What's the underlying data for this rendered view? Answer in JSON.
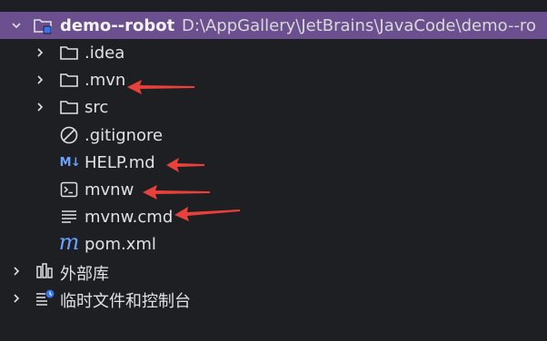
{
  "project": {
    "name": "demo--robot",
    "path": "D:\\AppGallery\\JetBrains\\JavaCode\\demo--ro"
  },
  "items": [
    {
      "label": ".idea",
      "icon": "folder-icon"
    },
    {
      "label": ".mvn",
      "icon": "folder-icon"
    },
    {
      "label": "src",
      "icon": "folder-icon"
    },
    {
      "label": ".gitignore",
      "icon": "ignore-file-icon"
    },
    {
      "label": "HELP.md",
      "icon": "markdown-icon",
      "icon_text": "M↓"
    },
    {
      "label": "mvnw",
      "icon": "terminal-icon"
    },
    {
      "label": "mvnw.cmd",
      "icon": "text-file-icon"
    },
    {
      "label": "pom.xml",
      "icon": "maven-icon",
      "icon_text": "m"
    }
  ],
  "bottom": [
    {
      "label": "外部库",
      "icon": "library-icon"
    },
    {
      "label": "临时文件和控制台",
      "icon": "scratches-icon"
    }
  ],
  "colors": {
    "background": "#1e1f22",
    "selection": "#6b4f8f",
    "arrow": "#e8413c",
    "accent_blue": "#6aa2ff"
  }
}
